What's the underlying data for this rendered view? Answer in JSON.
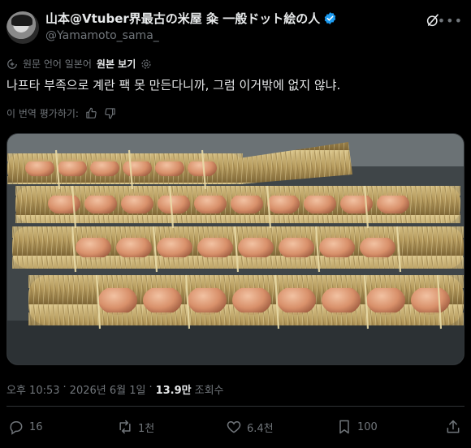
{
  "author": {
    "display_name": "山本@Vtuber界最古の米屋 粂 一般ドット絵の人",
    "handle": "@Yamamoto_sama_"
  },
  "translation": {
    "translated_from": "원문 언어 일본어",
    "show_original": "원본 보기"
  },
  "post": {
    "text": "나프타 부족으로 계란 팩 못 만든다니까, 그럼 이거밖에 없지 않냐.",
    "rate_translation": "이 번역 평가하기:"
  },
  "meta": {
    "time": "오후 10:53",
    "separator": "·",
    "date": "2026년 6월 1일",
    "views_count": "13.9만",
    "views_label": "조회수"
  },
  "actions": {
    "replies": "16",
    "reposts": "1천",
    "likes": "6.4천",
    "bookmarks": "100"
  },
  "colors": {
    "background": "#000000",
    "text": "#e7e9ea",
    "muted": "#71767b",
    "verified": "#1d9bf0",
    "divider": "#2f3336"
  }
}
